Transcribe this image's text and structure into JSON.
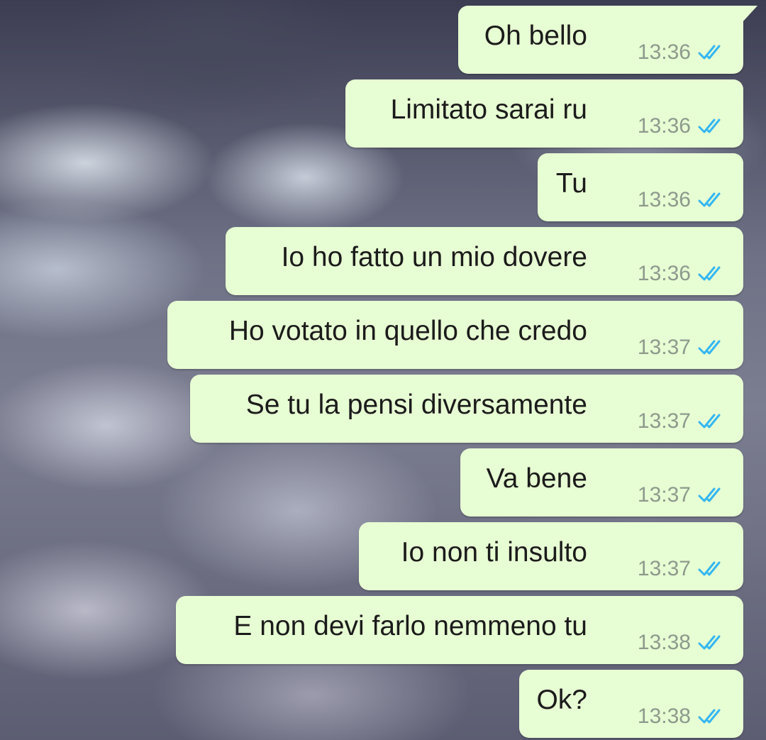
{
  "chat": {
    "accent": {
      "bubble_bg": "#e7fdd3",
      "tick_color": "#34b7f1",
      "time_color": "#8d9a8d"
    },
    "messages": [
      {
        "text": "Oh bello",
        "time": "13:36",
        "status": "read"
      },
      {
        "text": "Limitato sarai ru",
        "time": "13:36",
        "status": "read"
      },
      {
        "text": "Tu",
        "time": "13:36",
        "status": "read"
      },
      {
        "text": "Io ho fatto un mio dovere",
        "time": "13:36",
        "status": "read"
      },
      {
        "text": "Ho votato in quello che credo",
        "time": "13:37",
        "status": "read"
      },
      {
        "text": "Se tu la pensi diversamente",
        "time": "13:37",
        "status": "read"
      },
      {
        "text": "Va bene",
        "time": "13:37",
        "status": "read"
      },
      {
        "text": "Io non ti insulto",
        "time": "13:37",
        "status": "read"
      },
      {
        "text": "E non devi farlo nemmeno tu",
        "time": "13:38",
        "status": "read"
      },
      {
        "text": "Ok?",
        "time": "13:38",
        "status": "read"
      }
    ]
  }
}
